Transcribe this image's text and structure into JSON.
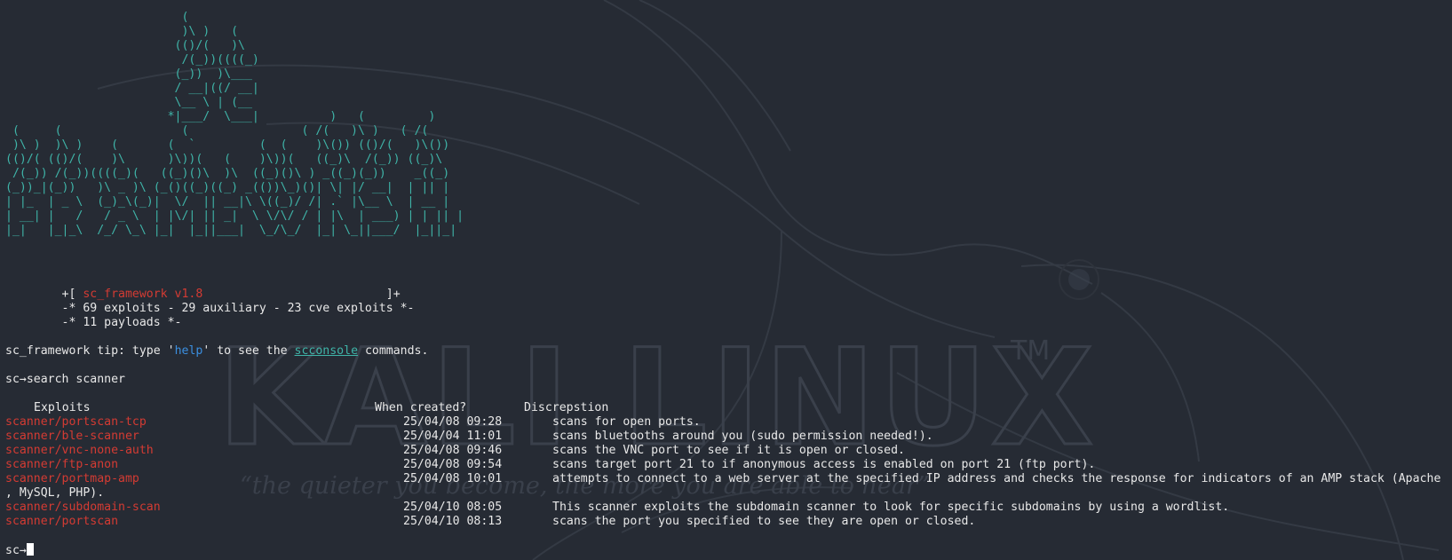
{
  "banner_art": [
    "                         (",
    "                         )\\ )   (",
    "                        (()/(   )\\",
    "                         /(_))((((_)",
    "                        (_))  )\\___",
    "                        / __|((/ __|",
    "                        \\__ \\ | (__",
    "                       *|___/  \\___|          )   (         )",
    " (     (                 (                ( /(   )\\ )   ( /(",
    " )\\ )  )\\ )    (       (  `         (  (    )\\()) (()/(   )\\())",
    "(()/( (()/(    )\\      )\\))(   (    )\\))(   ((_)\\  /(_)) ((_)\\",
    " /(_)) /(_))((((_)(   ((_)()\\  )\\  ((_)()\\ ) _((_)(_))    _((_)",
    "(_))_|(_))   )\\ _ )\\ (_()((_)((_) _(())\\_)()| \\| |/ __|  | || |",
    "| |_  | _ \\  (_)_\\(_)|  \\/  || __|\\ \\((_)/ /| .` |\\__ \\  | __ |",
    "| __| |   /   / _ \\  | |\\/| || _|  \\ \\/\\/ / | |\\  | ___) | | || |",
    "|_|   |_|_\\  /_/ \\_\\ |_|  |_||___|  \\_/\\_/  |_| \\_||___/  |_||_|"
  ],
  "info": {
    "line1_prefix": "        +[ ",
    "framework_name": "sc_framework v1.8",
    "line1_suffix": "                          ]+",
    "line2": "        -* 69 exploits - 29 auxiliary - 23 cve exploits *-",
    "line3": "        -* 11 payloads *-"
  },
  "tip": {
    "prefix": "sc_framework tip: type '",
    "help_word": "help",
    "middle": "' to see the ",
    "console_word": "scconsole",
    "suffix": " commands."
  },
  "command": {
    "prompt": "sc→",
    "text": "search scanner"
  },
  "table": {
    "headers": {
      "name": "Exploits",
      "created": "When created?",
      "description": "Discrepstion"
    },
    "rows": [
      {
        "name": "scanner/portscan-tcp",
        "created": "25/04/08 09:28",
        "description": "scans for open ports."
      },
      {
        "name": "scanner/ble-scanner",
        "created": "25/04/04 11:01",
        "description": "scans bluetooths around you (sudo permission needed!)."
      },
      {
        "name": "scanner/vnc-none-auth",
        "created": "25/04/08 09:46",
        "description": "scans the VNC port to see if it is open or closed."
      },
      {
        "name": "scanner/ftp-anon",
        "created": "25/04/08 09:54",
        "description": "scans target port 21 to if anonymous access is enabled on port 21 (ftp port)."
      },
      {
        "name": "scanner/portmap-amp",
        "created": "25/04/08 10:01",
        "description": "attempts to connect to a web server at the specified IP address and checks the response for indicators of an AMP stack (Apache",
        "continuation": ", MySQL, PHP)."
      },
      {
        "name": "scanner/subdomain-scan",
        "created": "25/04/10 08:05",
        "description": "This scanner exploits the subdomain scanner to look for specific subdomains by using a wordlist."
      },
      {
        "name": "scanner/portscan",
        "created": "25/04/10 08:13",
        "description": "scans the port you specified to see they are open or closed."
      }
    ]
  },
  "final_prompt": "sc→",
  "wallpaper": {
    "title": "KALI LINUX",
    "trademark": "TM",
    "tagline": "“the quieter you become, the more you are able to hear”"
  },
  "colors": {
    "background": "#262b34",
    "text": "#e8e8e8",
    "banner": "#3fb4a8",
    "exploit_name": "#d43b33",
    "help_word": "#3b8fe0",
    "watermark": "#3a404b"
  }
}
